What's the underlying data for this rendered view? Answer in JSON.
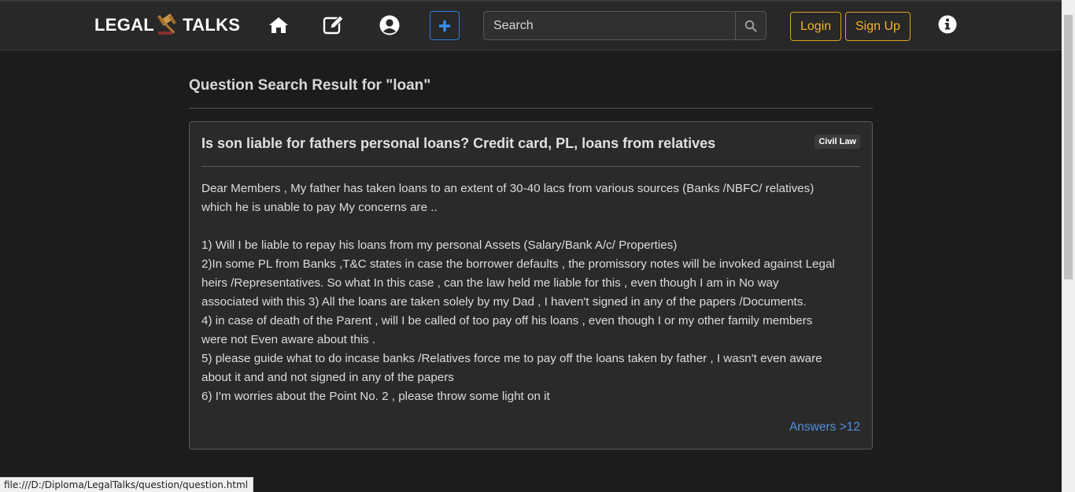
{
  "navbar": {
    "brand_left": "LEGAL",
    "brand_right": "TALKS",
    "search_placeholder": "Search",
    "login_label": "Login",
    "signup_label": "Sign Up"
  },
  "main": {
    "title": "Question Search Result for \"loan\"",
    "question": {
      "title": "Is son liable for fathers personal loans? Credit card, PL, loans from relatives",
      "category": "Civil Law",
      "body_lines": [
        "Dear Members , My father has taken loans to an extent of 30-40 lacs from various sources (Banks /NBFC/ relatives)",
        "which he is unable to pay My concerns are ..",
        "",
        "1) Will I be liable to repay his loans from my personal Assets (Salary/Bank A/c/ Properties)",
        "2)In some PL from Banks ,T&C states in case the borrower defaults , the promissory notes will be invoked against Legal",
        "heirs /Representatives. So what In this case , can the law held me liable for this , even though I am in No way",
        "associated with this 3) All the loans are taken solely by my Dad , I haven't signed in any of the papers /Documents.",
        "4) in case of death of the Parent , will I be called of too pay off his loans , even though I or my other family members",
        "were not Even aware about this .",
        "5) please guide what to do incase banks /Relatives force me to pay off the loans taken by father , I wasn't even aware",
        "about it and and not signed in any of the papers",
        "6) I'm worries about the Point No. 2 , please throw some light on it"
      ],
      "answers_label": "Answers >12"
    }
  },
  "status_bar": {
    "url": "file:///D:/Diploma/LegalTalks/question/question.html"
  },
  "colors": {
    "accent_blue": "#2f7ddb",
    "auth_gold": "#d9a520",
    "link_blue": "#4e8fe0"
  }
}
